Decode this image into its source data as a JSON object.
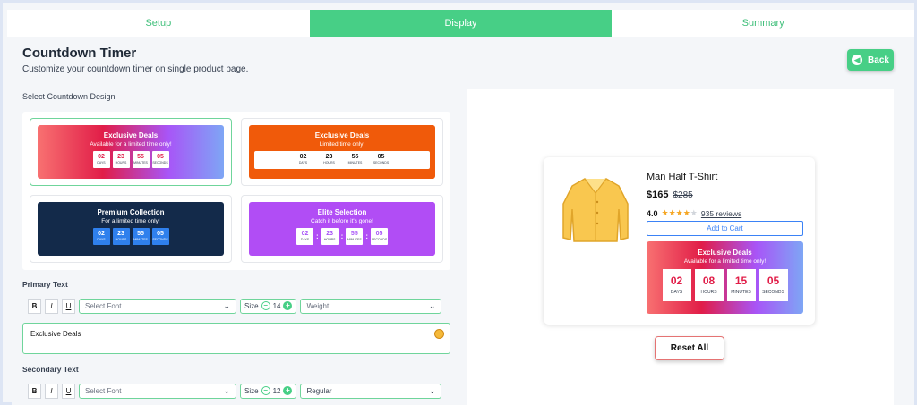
{
  "steps": [
    {
      "label": "Setup"
    },
    {
      "label": "Display"
    },
    {
      "label": "Summary"
    }
  ],
  "header": {
    "title": "Countdown Timer",
    "subtitle": "Customize your countdown timer on single product page.",
    "back_label": "Back"
  },
  "designs": {
    "section_label": "Select Countdown Design",
    "items": [
      {
        "heading": "Exclusive Deals",
        "sub": "Available for a limited time only!",
        "days": "02",
        "hours": "23",
        "minutes": "55",
        "seconds": "05"
      },
      {
        "heading": "Exclusive Deals",
        "sub": "Limited time only!",
        "days": "02",
        "hours": "23",
        "minutes": "55",
        "seconds": "05"
      },
      {
        "heading": "Premium Collection",
        "sub": "For a limited time only!",
        "days": "02",
        "hours": "23",
        "minutes": "55",
        "seconds": "05"
      },
      {
        "heading": "Elite Selection",
        "sub": "Catch it before it's gone!",
        "days": "02",
        "hours": "23",
        "minutes": "55",
        "seconds": "05"
      }
    ],
    "units": {
      "days": "DAYS",
      "hours": "HOURS",
      "minutes": "MINUTES",
      "seconds": "SECONDS"
    }
  },
  "primary": {
    "label": "Primary Text",
    "font_placeholder": "Select Font",
    "size_label": "Size",
    "size": "14",
    "weight": "Weight",
    "text": "Exclusive Deals"
  },
  "secondary": {
    "label": "Secondary Text",
    "font_placeholder": "Select Font",
    "size_label": "Size",
    "size": "12",
    "weight": "Regular"
  },
  "format": {
    "bold": "B",
    "italic": "I",
    "underline": "U"
  },
  "preview": {
    "product_name": "Man Half T-Shirt",
    "price": "$165",
    "old_price": "$285",
    "rating": "4.0",
    "rating_value": 4,
    "reviews": "935 reviews",
    "cart_label": "Add to Cart",
    "timer": {
      "heading": "Exclusive Deals",
      "sub": "Available for a limited time only!",
      "days": "02",
      "hours": "08",
      "minutes": "15",
      "seconds": "05",
      "u_days": "DAYS",
      "u_hours": "HOURS",
      "u_minutes": "MINUTES",
      "u_seconds": "SECONDS"
    },
    "reset_label": "Reset All"
  },
  "colors": {
    "accent": "#47cf86",
    "danger": "#e11d48",
    "link": "#3b82f6"
  }
}
